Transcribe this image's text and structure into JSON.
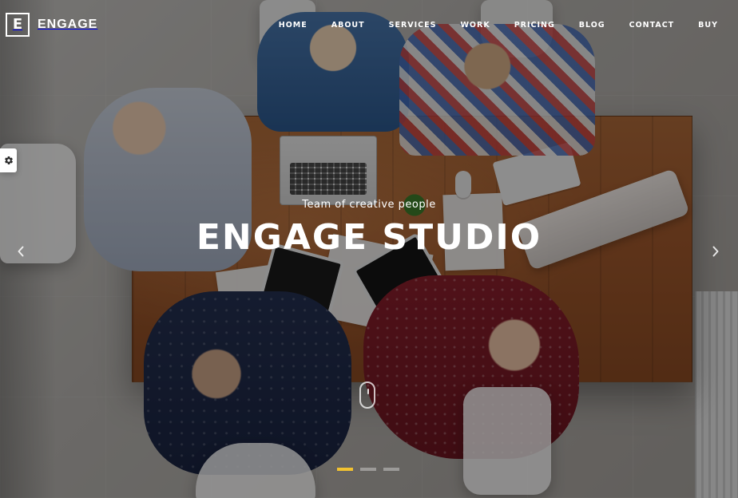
{
  "header": {
    "logo": {
      "mark": "E",
      "text": "ENGAGE"
    },
    "nav": [
      {
        "label": "HOME"
      },
      {
        "label": "ABOUT"
      },
      {
        "label": "SERVICES"
      },
      {
        "label": "WORK"
      },
      {
        "label": "PRICING"
      },
      {
        "label": "BLOG"
      },
      {
        "label": "CONTACT"
      },
      {
        "label": "BUY"
      }
    ]
  },
  "hero": {
    "subtitle": "Team of creative people",
    "title": "ENGAGE STUDIO"
  },
  "controls": {
    "settings_icon": "gear-icon",
    "left_arrow_icon": "chevron-left-icon",
    "right_arrow_icon": "chevron-right-icon",
    "scroll_icon": "mouse-scroll-icon"
  },
  "slider": {
    "active_index": 0,
    "count": 3
  },
  "colors": {
    "accent": "#F2C230",
    "text": "#FFFFFF",
    "overlay": "#000000"
  }
}
